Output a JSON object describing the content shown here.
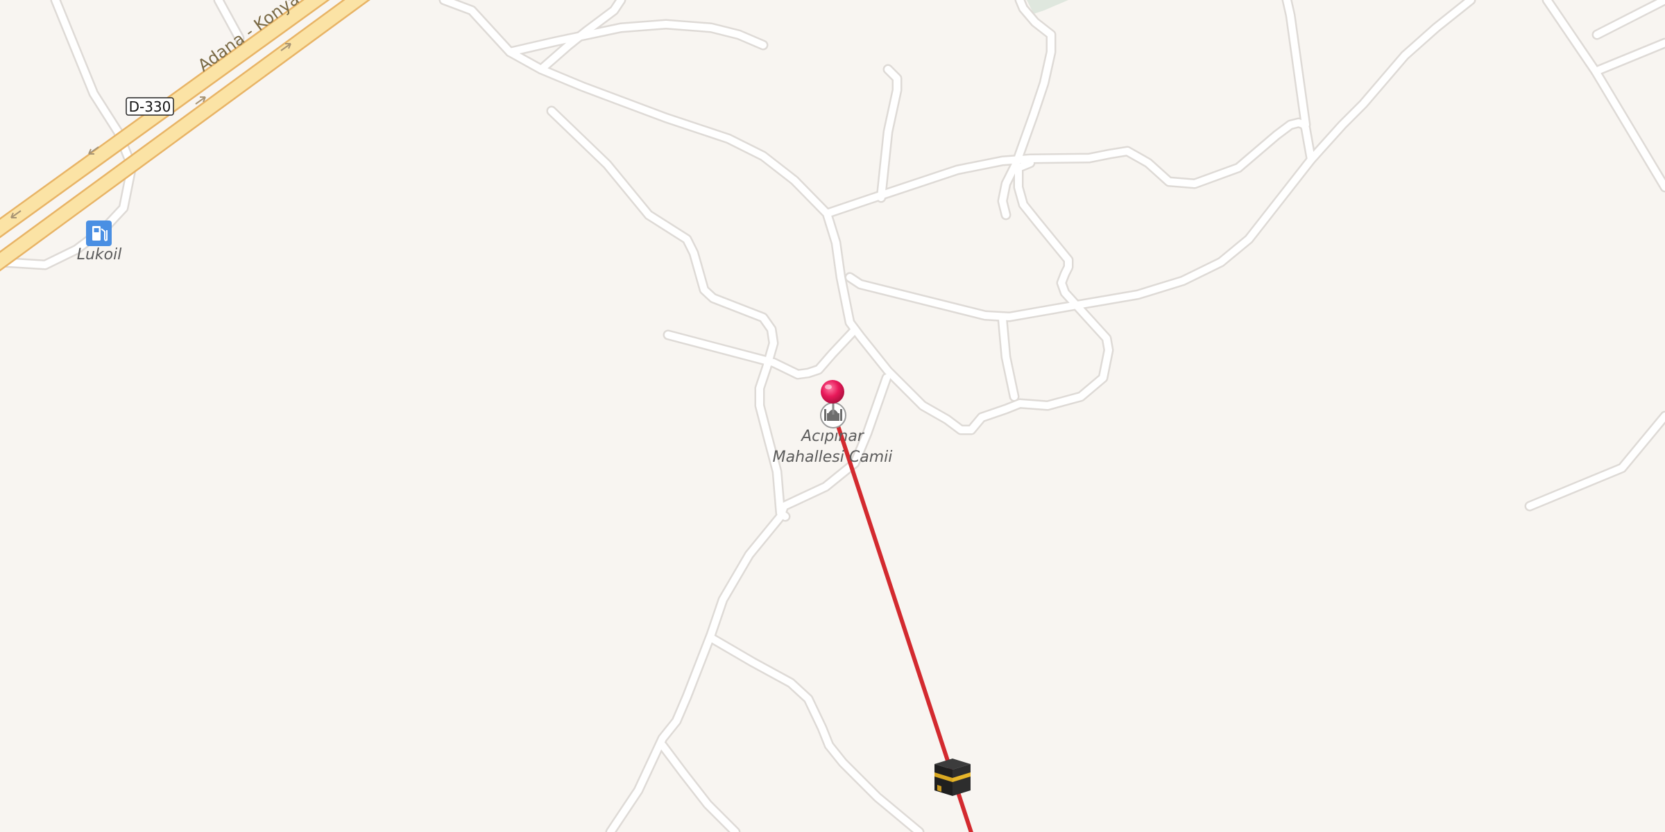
{
  "map": {
    "highway": {
      "name": "Adana - Konya",
      "shield": "D-330",
      "color": "#fbe3a5"
    },
    "pois": [
      {
        "id": "fuel",
        "name": "Lukoil",
        "icon": "fuel-station-icon",
        "color": "#4a8fe3"
      },
      {
        "id": "mosque",
        "name_line1": "Acıpınar",
        "name_line2": "Mahallesi Camii",
        "icon": "mosque-icon"
      }
    ],
    "location_pin": {
      "icon": "map-pin-icon",
      "color": "#e8195a"
    },
    "qibla": {
      "icon": "kaaba-icon",
      "line_color": "#d32a2f"
    }
  }
}
